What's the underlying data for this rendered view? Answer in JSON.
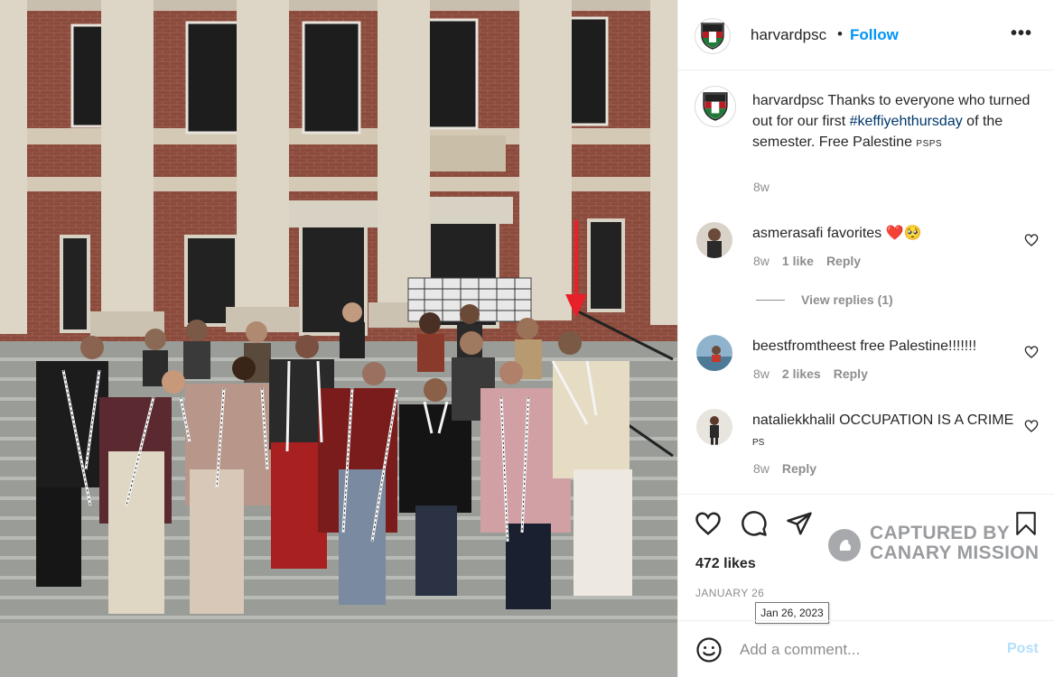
{
  "post": {
    "username": "harvardpsc",
    "follow_label": "Follow",
    "header_dot": "•",
    "more_label": "•••",
    "logo_icon": "shield-logo-icon",
    "caption": {
      "username": "harvardpsc",
      "text_before": "Thanks to everyone who turned out for our first ",
      "hashtag": "#keffiyehthursday",
      "text_after": " of the semester. Free Palestine ",
      "flag": "PSPS",
      "time": "8w"
    }
  },
  "comments": [
    {
      "username": "asmerasafi",
      "text": "favorites",
      "emoji": "❤️🥺",
      "time": "8w",
      "likes": "1 like",
      "reply_label": "Reply",
      "view_replies": "View replies (1)"
    },
    {
      "username": "beestfromtheest",
      "text": "free Palestine!!!!!!!",
      "time": "8w",
      "likes": "2 likes",
      "reply_label": "Reply"
    },
    {
      "username": "nataliekkhalil",
      "text": "OCCUPATION IS A CRIME",
      "flag": "PS",
      "time": "8w",
      "reply_label": "Reply"
    }
  ],
  "actions": {
    "likes": "472 likes",
    "date": "JANUARY 26",
    "date_tooltip": "Jan 26, 2023"
  },
  "watermark": {
    "line1": "CAPTURED BY",
    "line2": "CANARY MISSION"
  },
  "add_comment": {
    "placeholder": "Add a comment...",
    "post_label": "Post"
  },
  "colors": {
    "link_blue": "#0095f6",
    "hashtag_blue": "#00376b",
    "muted_gray": "#8e8e8e",
    "arrow_red": "#e8202a",
    "post_disabled": "#b2dffc"
  }
}
